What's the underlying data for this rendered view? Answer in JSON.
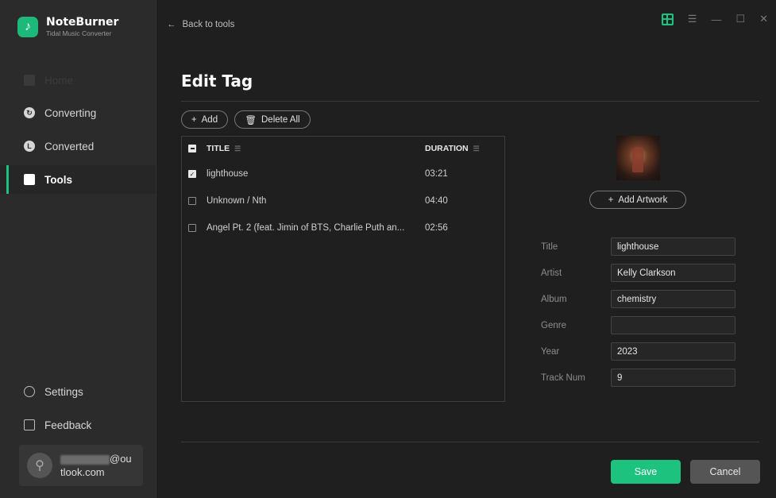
{
  "app": {
    "name": "NoteBurner",
    "subtitle": "Tidal Music Converter"
  },
  "sidebar": {
    "items": [
      {
        "label": "Home",
        "state": "disabled"
      },
      {
        "label": "Converting",
        "state": "normal"
      },
      {
        "label": "Converted",
        "state": "normal"
      },
      {
        "label": "Tools",
        "state": "active"
      }
    ],
    "settings_label": "Settings",
    "feedback_label": "Feedback",
    "user": {
      "email_part1": "@ou",
      "email_part2": "tlook.com"
    }
  },
  "header": {
    "back_label": "Back to tools"
  },
  "page": {
    "title": "Edit Tag"
  },
  "toolbar": {
    "add_label": "Add",
    "delete_all_label": "Delete All"
  },
  "table": {
    "headers": {
      "title": "TITLE",
      "duration": "DURATION"
    },
    "rows": [
      {
        "title": "lighthouse",
        "duration": "03:21",
        "checked": true
      },
      {
        "title": "Unknown / Nth",
        "duration": "04:40",
        "checked": false
      },
      {
        "title": "Angel Pt. 2 (feat. Jimin of BTS, Charlie Puth an...",
        "duration": "02:56",
        "checked": false
      }
    ]
  },
  "artwork": {
    "add_label": "Add Artwork"
  },
  "form": {
    "title_label": "Title",
    "title_value": "lighthouse",
    "artist_label": "Artist",
    "artist_value": "Kelly Clarkson",
    "album_label": "Album",
    "album_value": "chemistry",
    "genre_label": "Genre",
    "genre_value": "",
    "year_label": "Year",
    "year_value": "2023",
    "track_label": "Track Num",
    "track_value": "9"
  },
  "actions": {
    "save_label": "Save",
    "cancel_label": "Cancel"
  },
  "colors": {
    "accent": "#1ec27f",
    "background": "#1f1f1f",
    "sidebar": "#2b2b2b"
  }
}
